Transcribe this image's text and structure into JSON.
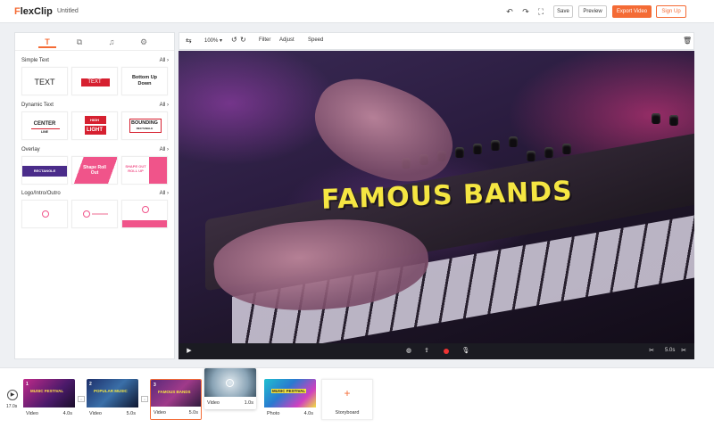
{
  "app": {
    "logo_prefix": "F",
    "logo_rest": "lexClip",
    "doc_title": "Untitled"
  },
  "topbar": {
    "undo": "↶",
    "redo": "↷",
    "fit": "⛶",
    "save": "Save",
    "preview": "Preview",
    "export": "Export Video",
    "signup": "Sign Up"
  },
  "panel": {
    "tabs": [
      "T",
      "⧉",
      "♫",
      "⚙"
    ],
    "sections": [
      {
        "title": "Simple Text",
        "all": "All ›"
      },
      {
        "title": "Dynamic Text",
        "all": "All ›"
      },
      {
        "title": "Overlay",
        "all": "All ›"
      },
      {
        "title": "Logo/Intro/Outro",
        "all": "All ›"
      }
    ],
    "simple": [
      "TEXT",
      "TEXT",
      "Bottom Up Down"
    ],
    "dynamic": [
      "CENTER",
      "LINE",
      "HIGH",
      "LIGHT",
      "BOUNDING",
      "RECTANGLE"
    ],
    "overlay": [
      "RECTANGLE",
      "Shape Roll Out",
      "SHAPE OUT ROLL UP"
    ]
  },
  "toolbar": {
    "zoom": "100% ▾",
    "filter": "Filter",
    "adjust": "Adjust",
    "speed": "Speed"
  },
  "video": {
    "title": "FAMOUS BANDS"
  },
  "playbar": {
    "duration": "5.0s"
  },
  "timeline": {
    "total": "17.0s",
    "clips": [
      {
        "num": "1",
        "type": "Video",
        "dur": "4.0s",
        "caption": "MUSIC FESTIVAL"
      },
      {
        "num": "2",
        "type": "Video",
        "dur": "5.0s",
        "caption": "POPULAR MUSIC"
      },
      {
        "num": "3",
        "type": "Video",
        "dur": "5.0s",
        "caption": "FAMOUS BANDS"
      },
      {
        "num": "",
        "type": "Video",
        "dur": "1.0s",
        "caption": ""
      },
      {
        "num": "",
        "type": "Photo",
        "dur": "4.0s",
        "caption": "MUSIC FESTIVAL"
      }
    ],
    "storyboard": "Storyboard",
    "plus": "+"
  },
  "colors": {
    "accent": "#f46b35",
    "title_yellow": "#f5e642"
  }
}
